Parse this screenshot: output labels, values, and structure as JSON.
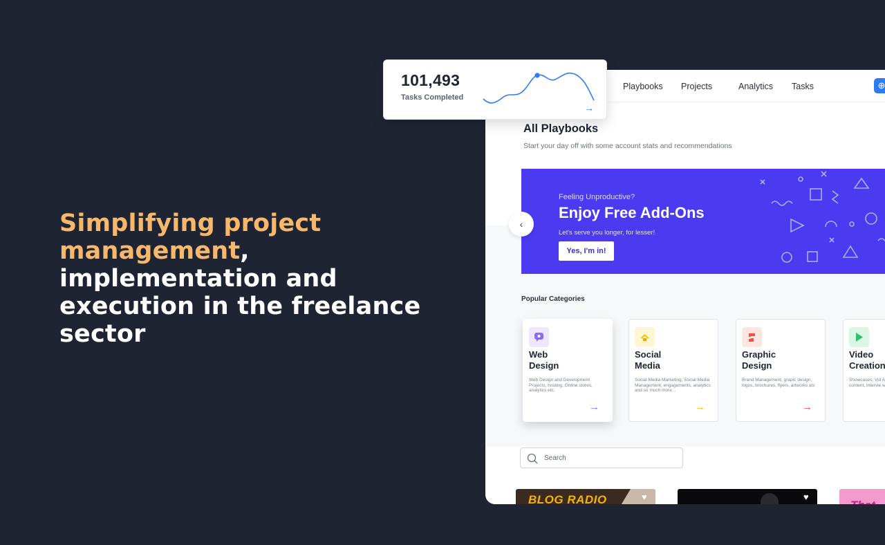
{
  "headline": {
    "highlight": "Simplifying project management",
    "rest": ", implementation and execution in the freelance sector"
  },
  "stat": {
    "value": "101,493",
    "label": "Tasks Completed",
    "arrow": "→",
    "line_color": "#2f7bf5"
  },
  "nav": {
    "items": [
      "Playbooks",
      "Projects",
      "Analytics",
      "Tasks"
    ],
    "add_icon": "⊕"
  },
  "page": {
    "title": "All Playbooks",
    "subtitle": "Start your day off with some account stats and recommendations"
  },
  "banner": {
    "kicker": "Feeling Unproductive?",
    "title": "Enjoy Free Add-Ons",
    "text": "Let's serve you longer, for lesser!",
    "cta": "Yes, I'm in!",
    "color": "#4b3af0"
  },
  "prev_icon": "‹",
  "categories": {
    "title": "Popular Categories",
    "items": [
      {
        "name": "Web\nDesign",
        "desc": "Web Design and Development Projects, hosting, Online stores, analytics etc.",
        "color": "#8b6cf0",
        "icon": "chat-icon"
      },
      {
        "name": "Social\nMedia",
        "desc": "Social Media Marketing, Social Media Management, engagements, analytics and so much more...",
        "color": "#f5c400",
        "icon": "megaphone-icon"
      },
      {
        "name": "Graphic\nDesign",
        "desc": "Brand Management, grapic design, logos, brochures, flyers, artworks etc",
        "color": "#f0523d",
        "icon": "brush-icon"
      },
      {
        "name": "Video\nCreation",
        "desc": "Showcases, Vid Animations, Voi content, Intervie whole nine Yard",
        "color": "#2ec16b",
        "icon": "play-icon"
      }
    ],
    "arrow": "→"
  },
  "search": {
    "placeholder": "Search"
  },
  "thumbs": [
    {
      "text": "BLOG RADIO",
      "heart": "♥"
    },
    {
      "text": "",
      "heart": "♥"
    },
    {
      "text": "That",
      "heart": ""
    }
  ]
}
